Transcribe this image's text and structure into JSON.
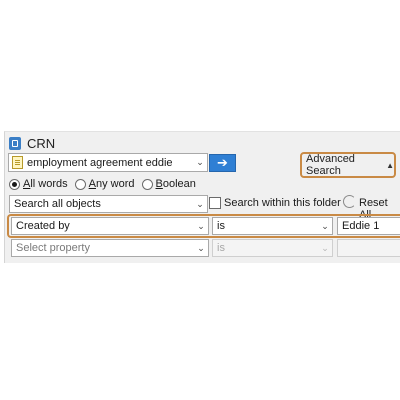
{
  "vault": {
    "title": "CRN"
  },
  "search": {
    "query": "employment agreement eddie",
    "go_icon": "arrow-right-icon",
    "advanced_label": "Advanced Search",
    "advanced_icon": "triangle-up-icon"
  },
  "match_mode": {
    "options": [
      {
        "label": "All words",
        "checked": true
      },
      {
        "label": "Any word",
        "checked": false
      },
      {
        "label": "Boolean",
        "checked": false
      }
    ]
  },
  "scope": {
    "selected": "Search all objects",
    "within_folder_label": "Search within this folder",
    "within_folder_checked": false,
    "reset_label": "Reset All"
  },
  "conditions": [
    {
      "property": "Created by",
      "operator": "is",
      "value": "Eddie 1"
    },
    {
      "property": "Select property",
      "operator": "is",
      "value": ""
    }
  ],
  "colors": {
    "highlight": "#c98a45",
    "accent": "#2f7fd4"
  }
}
